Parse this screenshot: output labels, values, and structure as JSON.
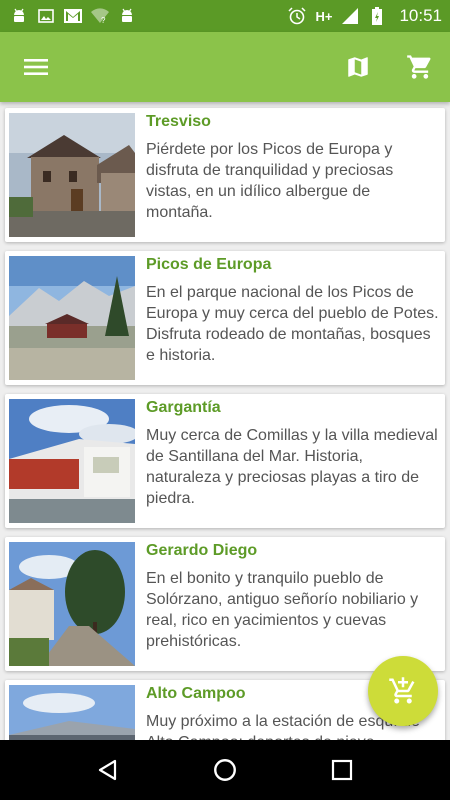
{
  "status_bar": {
    "time": "10:51",
    "network": "H+",
    "icons": [
      "android-icon",
      "image-icon",
      "gmail-icon",
      "wifi-unknown-icon",
      "android-icon",
      "alarm-icon",
      "signal-icon",
      "battery-icon"
    ]
  },
  "toolbar": {
    "icons": [
      "menu-icon",
      "map-icon",
      "cart-icon"
    ],
    "color": "#8bc34a"
  },
  "listings": [
    {
      "title": "Tresviso",
      "description": "Piérdete por los Picos de Europa y disfruta de tranquilidad y preciosas vistas, en un idílico albergue de montaña."
    },
    {
      "title": "Picos de Europa",
      "description": "En el parque nacional de los Picos de Europa y muy cerca del pueblo de Potes. Disfruta rodeado de montañas, bosques e historia."
    },
    {
      "title": "Gargantía",
      "description": "Muy cerca de Comillas y la villa medieval de Santillana del Mar. Historia, naturaleza y preciosas playas a tiro de piedra."
    },
    {
      "title": "Gerardo Diego",
      "description": "En el bonito y tranquilo pueblo de Solórzano, antiguo señorío nobiliario y real, rico en yacimientos y cuevas prehistóricas."
    },
    {
      "title": "Alto Campoo",
      "description": "Muy próximo  a la estación de esquí de Alto Campoo: deportes de nieve"
    }
  ],
  "fab": {
    "icon": "add-to-cart-icon",
    "color": "#cddc39"
  },
  "colors": {
    "title": "#5d9b27",
    "statusbar": "#5b9a26"
  }
}
